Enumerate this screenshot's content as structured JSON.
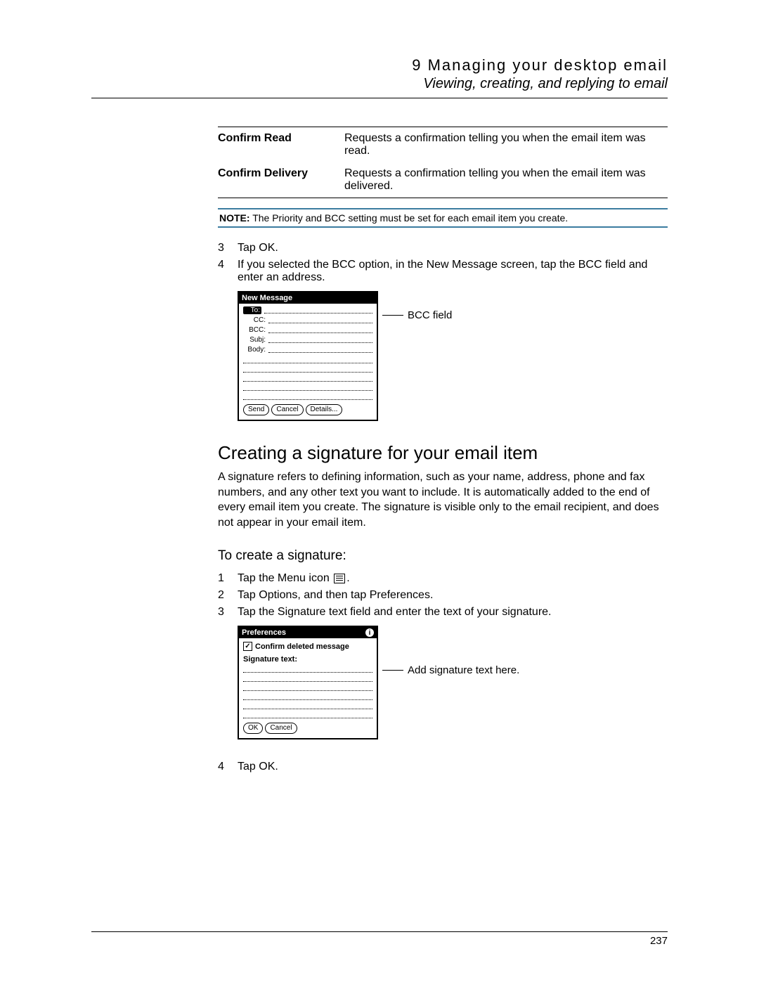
{
  "header": {
    "chapter_num": "9",
    "chapter_title": "Managing your desktop email",
    "section_title": "Viewing, creating, and replying to email"
  },
  "definitions": [
    {
      "term": "Confirm Read",
      "desc": "Requests a confirmation telling you when the email item was read."
    },
    {
      "term": "Confirm Delivery",
      "desc": "Requests a confirmation telling you when the email item was delivered."
    }
  ],
  "note": {
    "label": "NOTE:",
    "text": "The Priority and BCC setting must be set for each email item you create."
  },
  "steps_a": [
    {
      "n": "3",
      "text": "Tap OK."
    },
    {
      "n": "4",
      "text": "If you selected the BCC option, in the New Message screen, tap the BCC field and enter an address."
    }
  ],
  "figure1": {
    "title": "New Message",
    "fields": {
      "to": "To:",
      "cc": "CC:",
      "bcc": "BCC:",
      "subj": "Subj:",
      "body": "Body:"
    },
    "buttons": {
      "send": "Send",
      "cancel": "Cancel",
      "details": "Details..."
    },
    "callout": "BCC field"
  },
  "section2": {
    "heading": "Creating a signature for your email item",
    "para": "A signature refers to defining information, such as your name, address, phone and fax numbers, and any other text you want to include. It is automatically added to the end of every email item you create. The signature is visible only to the email recipient, and does not appear in your email item.",
    "subheading": "To create a signature:"
  },
  "steps_b": [
    {
      "n": "1",
      "pre": "Tap the Menu icon ",
      "post": "."
    },
    {
      "n": "2",
      "text": "Tap Options, and then tap Preferences."
    },
    {
      "n": "3",
      "text": "Tap the Signature text field and enter the text of your signature."
    }
  ],
  "figure2": {
    "title": "Preferences",
    "checkbox_label": "Confirm deleted message",
    "sig_label": "Signature text:",
    "buttons": {
      "ok": "OK",
      "cancel": "Cancel"
    },
    "callout": "Add signature text here."
  },
  "steps_c": [
    {
      "n": "4",
      "text": "Tap OK."
    }
  ],
  "page_number": "237"
}
